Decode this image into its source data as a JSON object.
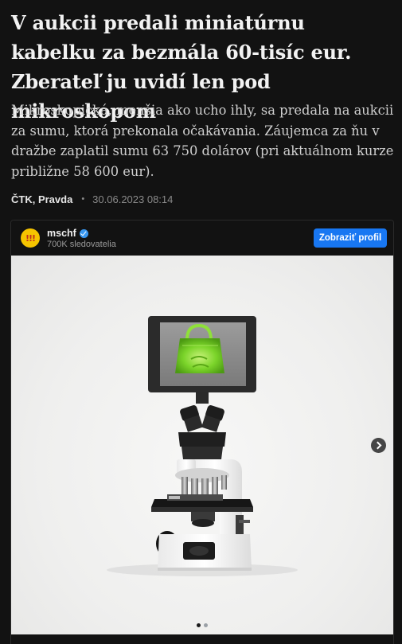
{
  "article": {
    "headline": "V aukcii predali miniatúrnu kabelku za bezmála 60-tisíc eur. Zberateľ ju uvidí len pod mikroskopom",
    "lede": "Mikroskopická, menšia ako ucho ihly, sa predala na aukcii za sumu, ktorá prekonala očakávania. Záujemca za ňu v dražbe zaplatil sumu 63 750 dolárov (pri aktuálnom kurze približne 58 600 eur).",
    "author": "ČTK, Pravda",
    "separator": "•",
    "date": "30.06.2023 08:14"
  },
  "embed": {
    "avatar_text": "!!!",
    "avatar_icon": "exclamation-logo-icon",
    "username": "mschf",
    "verified_icon": "verified-badge-icon",
    "followers": "700K sledovatelia",
    "profile_button_label": "Zobraziť profil",
    "next_icon": "chevron-right-icon",
    "carousel": {
      "current": 1,
      "total": 2
    },
    "colors": {
      "accent": "#1877f2",
      "background": "#121212",
      "bag_green": "#7bd42a"
    }
  }
}
